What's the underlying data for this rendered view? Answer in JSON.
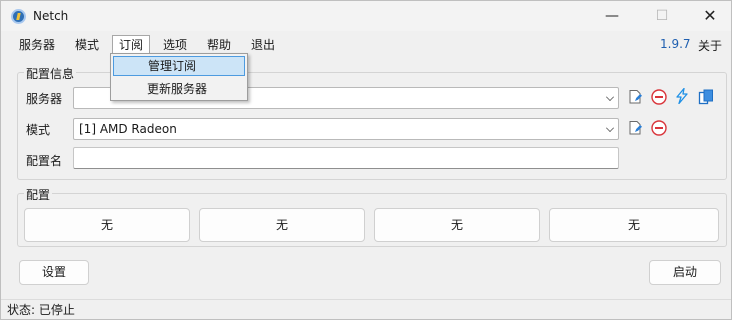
{
  "window": {
    "title": "Netch",
    "minimize_glyph": "—",
    "maximize_glyph": "☐",
    "close_glyph": "✕"
  },
  "menu": {
    "items": [
      "服务器",
      "模式",
      "订阅",
      "选项",
      "帮助",
      "退出"
    ],
    "open_item": "订阅",
    "version": "1.9.7",
    "about": "关于"
  },
  "dropdown": {
    "items": [
      "管理订阅",
      "更新服务器"
    ],
    "highlighted": "管理订阅"
  },
  "config_info": {
    "group_label": "配置信息",
    "server_label": "服务器",
    "server_value": "",
    "mode_label": "模式",
    "mode_value": "[1] AMD Radeon",
    "profile_name_label": "配置名",
    "profile_name_value": ""
  },
  "profiles": {
    "group_label": "配置",
    "buttons": [
      "无",
      "无",
      "无",
      "无"
    ]
  },
  "actions": {
    "settings": "设置",
    "start": "启动"
  },
  "status": {
    "text": "状态: 已停止"
  },
  "colors": {
    "accent": "#1f5fb0",
    "menu_highlight": "#cce4f7",
    "menu_highlight_border": "#4d9be0",
    "delete_red": "#d9343a",
    "speed_blue": "#1e90e6"
  },
  "icons": {
    "server_tools": [
      "edit-icon",
      "delete-icon",
      "speed-test-icon",
      "copy-icon"
    ],
    "mode_tools": [
      "edit-icon",
      "delete-icon"
    ]
  }
}
